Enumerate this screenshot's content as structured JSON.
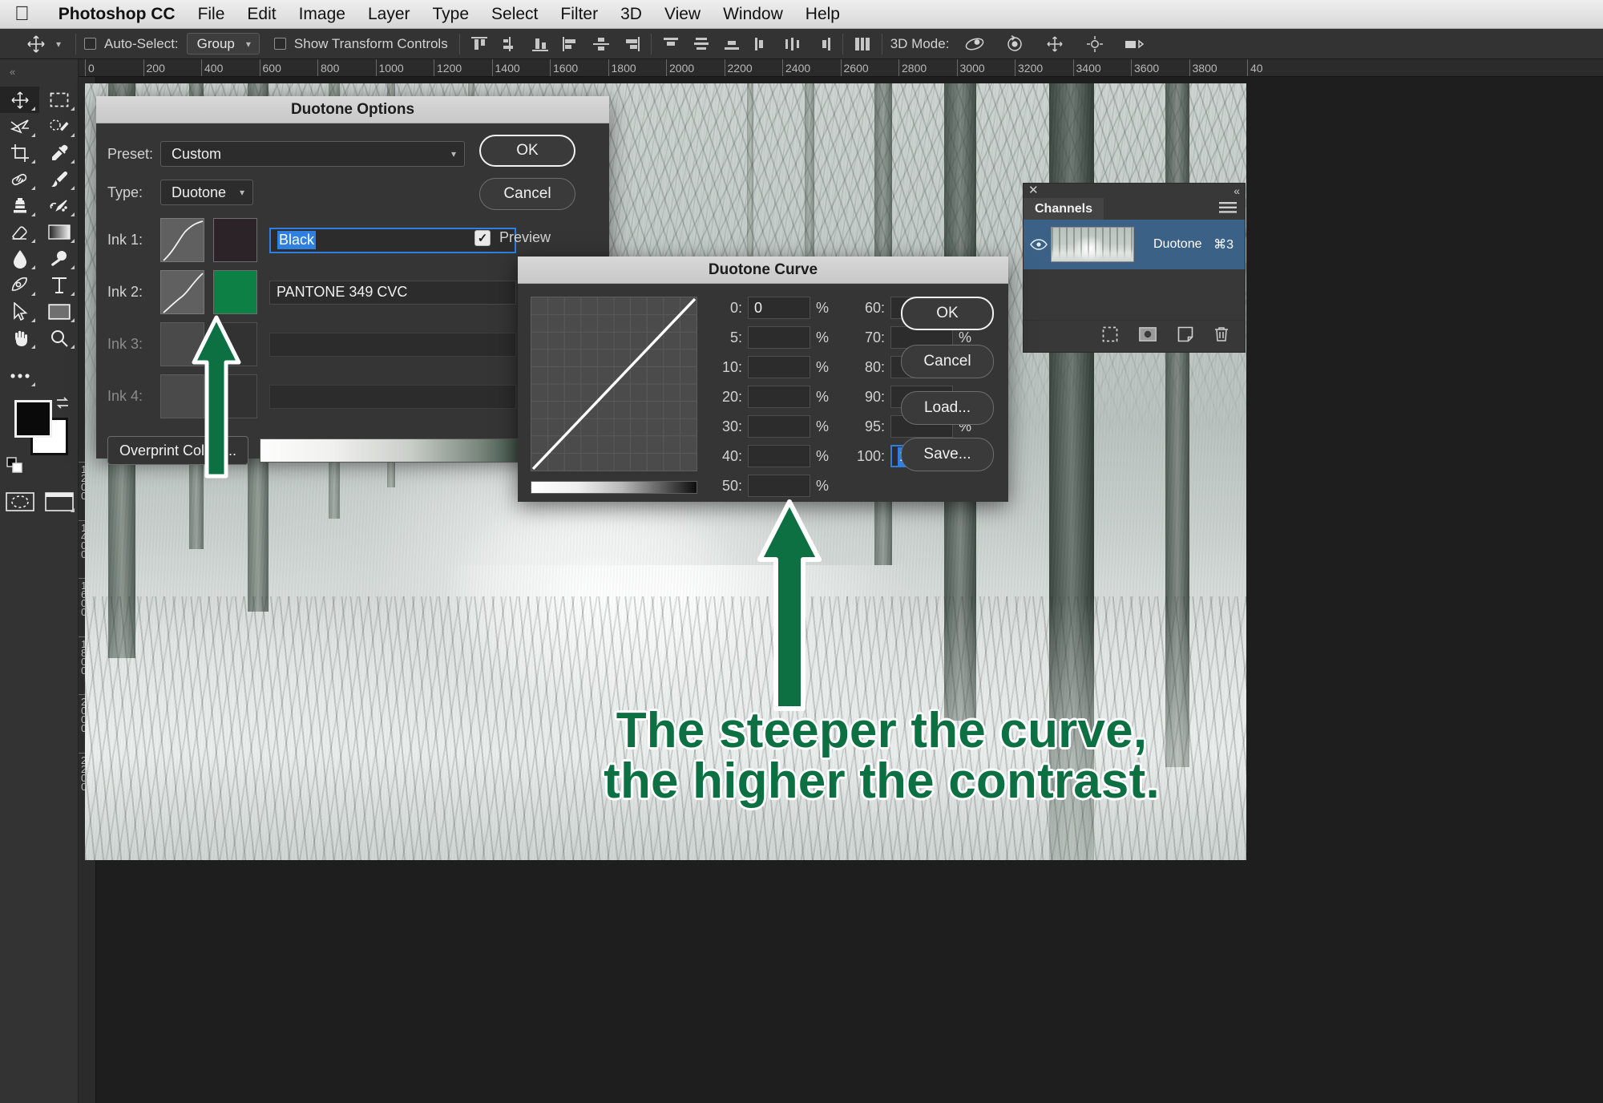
{
  "menubar": {
    "apple_icon": "apple-logo-icon",
    "items": [
      {
        "label": "Photoshop CC",
        "bold": true
      },
      {
        "label": "File"
      },
      {
        "label": "Edit"
      },
      {
        "label": "Image"
      },
      {
        "label": "Layer"
      },
      {
        "label": "Type"
      },
      {
        "label": "Select"
      },
      {
        "label": "Filter"
      },
      {
        "label": "3D"
      },
      {
        "label": "View"
      },
      {
        "label": "Window"
      },
      {
        "label": "Help"
      }
    ]
  },
  "options_bar": {
    "active_tool_icon": "move-tool-icon",
    "auto_select_label": "Auto-Select:",
    "auto_select_checked": false,
    "auto_select_value": "Group",
    "show_transform_label": "Show Transform Controls",
    "show_transform_checked": false,
    "align_icons": [
      "align-top-edges-icon",
      "align-vertical-centers-icon",
      "align-bottom-edges-icon",
      "align-left-edges-icon",
      "align-horizontal-centers-icon",
      "align-right-edges-icon"
    ],
    "distribute_icons": [
      "distribute-top-edges-icon",
      "distribute-vertical-centers-icon",
      "distribute-bottom-edges-icon",
      "distribute-left-edges-icon",
      "distribute-horizontal-centers-icon",
      "distribute-right-edges-icon"
    ],
    "extra_icons": [
      "distribute-spacing-icon"
    ],
    "mode3d_label": "3D Mode:",
    "mode3d_icons": [
      "orbit-3d-icon",
      "roll-3d-icon",
      "pan-3d-icon",
      "slide-3d-icon",
      "scale-3d-icon"
    ]
  },
  "toolbar": {
    "tools": [
      {
        "name": "move-tool",
        "icon": "move-tool-icon",
        "active": true
      },
      {
        "name": "rectangular-marquee-tool",
        "icon": "marquee-icon",
        "active": false
      },
      {
        "name": "lasso-tool",
        "icon": "lasso-icon",
        "active": false
      },
      {
        "name": "quick-selection-tool",
        "icon": "quick-selection-icon",
        "active": false
      },
      {
        "name": "crop-tool",
        "icon": "crop-icon",
        "active": false
      },
      {
        "name": "eyedropper-tool",
        "icon": "eyedropper-icon",
        "active": false
      },
      {
        "name": "healing-brush-tool",
        "icon": "healing-brush-icon",
        "active": false
      },
      {
        "name": "brush-tool",
        "icon": "brush-icon",
        "active": false
      },
      {
        "name": "clone-stamp-tool",
        "icon": "clone-stamp-icon",
        "active": false
      },
      {
        "name": "history-brush-tool",
        "icon": "history-brush-icon",
        "active": false
      },
      {
        "name": "eraser-tool",
        "icon": "eraser-icon",
        "active": false
      },
      {
        "name": "gradient-tool",
        "icon": "gradient-icon",
        "active": false
      },
      {
        "name": "blur-tool",
        "icon": "blur-drop-icon",
        "active": false
      },
      {
        "name": "dodge-tool",
        "icon": "dodge-icon",
        "active": false
      },
      {
        "name": "pen-tool",
        "icon": "pen-icon",
        "active": false
      },
      {
        "name": "type-tool",
        "icon": "type-t-icon",
        "active": false
      },
      {
        "name": "path-selection-tool",
        "icon": "path-arrow-icon",
        "active": false
      },
      {
        "name": "rectangle-tool",
        "icon": "rectangle-shape-icon",
        "active": false
      },
      {
        "name": "hand-tool",
        "icon": "hand-icon",
        "active": false
      },
      {
        "name": "zoom-tool",
        "icon": "zoom-magnifier-icon",
        "active": false
      }
    ],
    "more_tools_icon": "ellipsis-icon",
    "foreground_color": "#0a0a0a",
    "background_color": "#ffffff",
    "swap_icon": "swap-colors-icon",
    "default_colors_icon": "default-colors-icon",
    "quick_mask_icon": "quick-mask-icon",
    "screen_mode_icon": "screen-mode-icon"
  },
  "rulers": {
    "unit": "px",
    "top_labels": [
      "0",
      "200",
      "400",
      "600",
      "800",
      "1000",
      "1200",
      "1400",
      "1600",
      "1800",
      "2000",
      "2200",
      "2400",
      "2600",
      "2800",
      "3000",
      "3200",
      "3400",
      "3600",
      "3800",
      "40"
    ],
    "left_labels": [
      "1200",
      "1400",
      "1600",
      "1800",
      "2000",
      "2200"
    ]
  },
  "channels_panel": {
    "close_icon": "close-icon",
    "collapse_icon": "collapse-panel-icon",
    "tab_label": "Channels",
    "menu_icon": "panel-menu-icon",
    "rows": [
      {
        "eye_icon": "eye-visible-icon",
        "thumbnail": "duotone-channel-thumbnail",
        "name": "Duotone",
        "shortcut": "⌘3",
        "selected": true
      }
    ],
    "footer_icons": [
      "load-channel-as-selection-icon",
      "save-selection-as-channel-icon",
      "create-new-channel-icon",
      "delete-channel-icon"
    ]
  },
  "duotone_options": {
    "title": "Duotone Options",
    "preset_label": "Preset:",
    "preset_value": "Custom",
    "preset_gear_icon": "gear-icon",
    "type_label": "Type:",
    "type_value": "Duotone",
    "ok_label": "OK",
    "cancel_label": "Cancel",
    "preview_label": "Preview",
    "preview_checked": true,
    "inks": [
      {
        "label": "Ink 1:",
        "color": "#2b2328",
        "name": "Black",
        "enabled": true,
        "focused": true,
        "selected_text": true,
        "curve_type": "slight-s"
      },
      {
        "label": "Ink 2:",
        "color": "#0d8046",
        "name": "PANTONE 349 CVC",
        "enabled": true,
        "focused": false,
        "selected_text": false,
        "curve_type": "steep-s"
      },
      {
        "label": "Ink 3:",
        "color": "",
        "name": "",
        "enabled": false,
        "focused": false,
        "selected_text": false,
        "curve_type": "none"
      },
      {
        "label": "Ink 4:",
        "color": "",
        "name": "",
        "enabled": false,
        "focused": false,
        "selected_text": false,
        "curve_type": "none"
      }
    ],
    "overprint_label": "Overprint Colors..."
  },
  "duotone_curve": {
    "title": "Duotone Curve",
    "ok_label": "OK",
    "cancel_label": "Cancel",
    "load_label": "Load...",
    "save_label": "Save...",
    "percent_symbol": "%",
    "fields_left": [
      {
        "key": "0:",
        "value": "0",
        "focused": false
      },
      {
        "key": "5:",
        "value": "",
        "focused": false
      },
      {
        "key": "10:",
        "value": "",
        "focused": false
      },
      {
        "key": "20:",
        "value": "",
        "focused": false
      },
      {
        "key": "30:",
        "value": "",
        "focused": false
      },
      {
        "key": "40:",
        "value": "",
        "focused": false
      },
      {
        "key": "50:",
        "value": "",
        "focused": false
      }
    ],
    "fields_right": [
      {
        "key": "60:",
        "value": "",
        "focused": false
      },
      {
        "key": "70:",
        "value": "",
        "focused": false
      },
      {
        "key": "80:",
        "value": "",
        "focused": false
      },
      {
        "key": "90:",
        "value": "",
        "focused": false
      },
      {
        "key": "95:",
        "value": "",
        "focused": false
      },
      {
        "key": "100:",
        "value": "100",
        "focused": true
      }
    ]
  },
  "annotation": {
    "line1": "The steeper the curve,",
    "line2": "the higher the contrast.",
    "color": "#0d7042",
    "outline_color": "#ffffff",
    "arrows": [
      {
        "name": "arrow-pointing-to-ink2-curve",
        "target": "ink-2 curve thumbnail"
      },
      {
        "name": "arrow-pointing-to-curve-graph",
        "target": "duotone curve graph"
      }
    ]
  }
}
